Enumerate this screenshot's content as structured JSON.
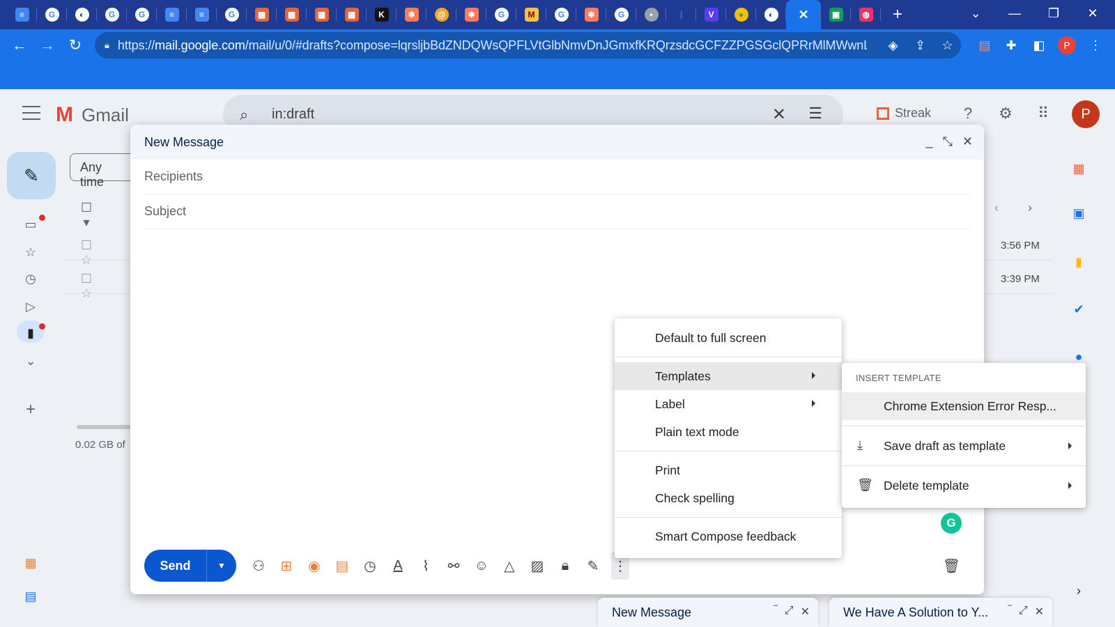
{
  "browser": {
    "url_prefix": "https://",
    "url_host": "mail.google.com",
    "url_path": "/mail/u/0/#drafts?compose=lqrsljbBdZNDQWsQPFLVtGlbNmvDnJGmxfKRQrzsdcGCFZZPGSGclQPRrMlMWwnLFzF...",
    "profile_initial": "P"
  },
  "gmail": {
    "logo": "Gmail",
    "search_query": "in:draft",
    "streak_label": "Streak",
    "avatar_initial": "P",
    "filter_chip": "Any time",
    "rows": [
      {
        "time": "3:56 PM"
      },
      {
        "time": "3:39 PM"
      }
    ],
    "storage": "0.02 GB of"
  },
  "compose": {
    "title": "New Message",
    "recipients_placeholder": "Recipients",
    "subject_placeholder": "Subject",
    "send_label": "Send"
  },
  "more_menu": {
    "items": [
      {
        "label": "Default to full screen"
      },
      {
        "label": "Templates"
      },
      {
        "label": "Label"
      },
      {
        "label": "Plain text mode"
      },
      {
        "label": "Print"
      },
      {
        "label": "Check spelling"
      },
      {
        "label": "Smart Compose feedback"
      }
    ]
  },
  "templates_menu": {
    "header": "INSERT TEMPLATE",
    "template": "Chrome Extension Error Resp...",
    "save": "Save draft as template",
    "delete": "Delete template"
  },
  "minimized": [
    {
      "title": "New Message"
    },
    {
      "title": "We Have A Solution to Y..."
    }
  ],
  "colors": {
    "chrome_blue": "#1a73e8",
    "send_blue": "#0b57d0",
    "grammarly_green": "#15c39a",
    "streak_orange": "#e8623a"
  }
}
